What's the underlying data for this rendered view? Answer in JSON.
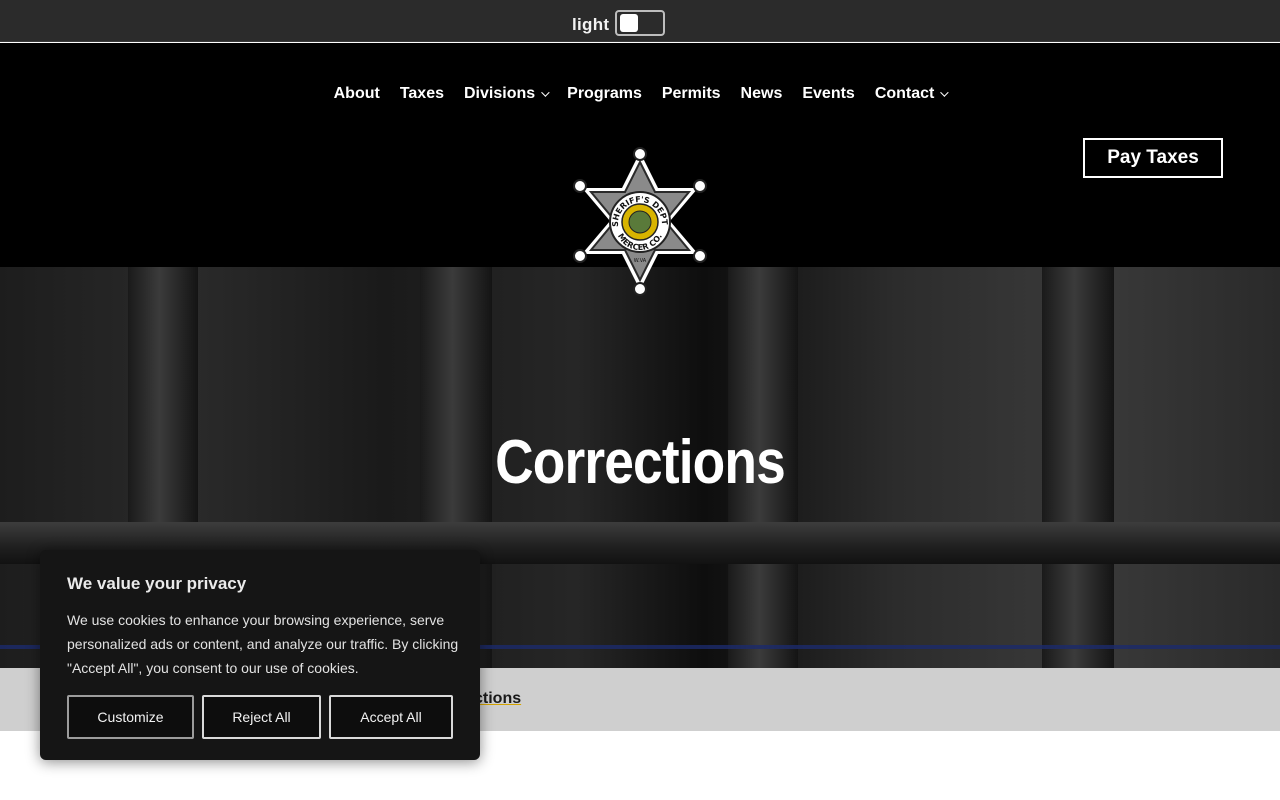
{
  "theme_toggle": {
    "label": "light"
  },
  "nav": {
    "items": [
      {
        "label": "About",
        "has_dropdown": false
      },
      {
        "label": "Taxes",
        "has_dropdown": false
      },
      {
        "label": "Divisions",
        "has_dropdown": true
      },
      {
        "label": "Programs",
        "has_dropdown": false
      },
      {
        "label": "Permits",
        "has_dropdown": false
      },
      {
        "label": "News",
        "has_dropdown": false
      },
      {
        "label": "Events",
        "has_dropdown": false
      },
      {
        "label": "Contact",
        "has_dropdown": true
      }
    ]
  },
  "header": {
    "pay_button_label": "Pay Taxes"
  },
  "logo": {
    "text_top": "SHERIFF'S DEPT.",
    "text_bottom": "MERCER CO.",
    "text_small": "W.VA"
  },
  "hero": {
    "title": "Corrections"
  },
  "breadcrumb": {
    "current_fragment": "ctions"
  },
  "cookie_banner": {
    "title": "We value your privacy",
    "body": "We use cookies to enhance your browsing experience, serve personalized ads or content, and analyze our traffic. By clicking \"Accept All\", you consent to our use of cookies.",
    "customize_label": "Customize",
    "reject_label": "Reject All",
    "accept_label": "Accept All"
  },
  "colors": {
    "header_bg": "#000000",
    "theme_bar_bg": "#2b2b2b",
    "cookie_bg": "#151515",
    "breadcrumb_bg": "#cfcfcf",
    "badge_gold": "#d8b400",
    "accent_blue": "#1c2a6b"
  }
}
